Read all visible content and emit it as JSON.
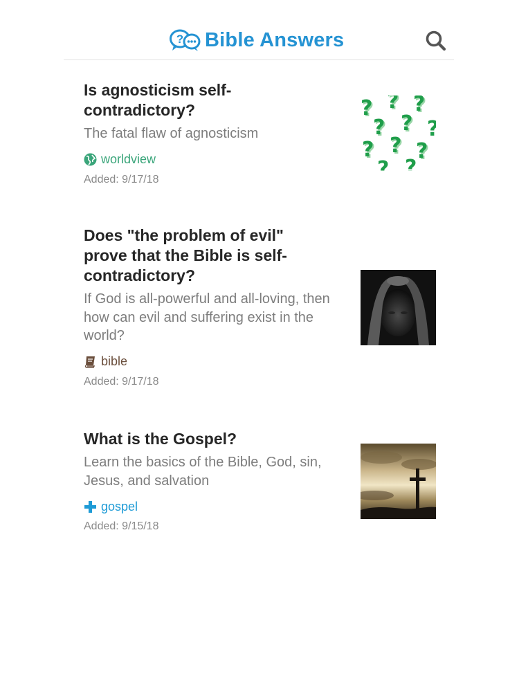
{
  "header": {
    "title": "Bible Answers",
    "logo_icon": "question-chat-bubbles-icon",
    "search_icon": "search-icon",
    "accent_color": "#2593d3"
  },
  "articles": [
    {
      "title": "Is agnosticism self-contradictory?",
      "subtitle": "The fatal flaw of agnosticism",
      "tag": "worldview",
      "tag_icon": "globe-icon",
      "tag_color": "#3aa57a",
      "date": "Added: 9/17/18",
      "thumbnail": "green-question-marks-image"
    },
    {
      "title": "Does \"the problem of evil\" prove that the Bible is self-contradictory?",
      "subtitle": "If God is all-powerful and all-loving, then how can evil and suffering exist in the world?",
      "tag": "bible",
      "tag_icon": "book-icon",
      "tag_color": "#6b4f3d",
      "date": "Added: 9/17/18",
      "thumbnail": "man-head-in-hands-image"
    },
    {
      "title": "What is the Gospel?",
      "subtitle": "Learn the basics of the Bible, God, sin, Jesus, and salvation",
      "tag": "gospel",
      "tag_icon": "plus-cross-icon",
      "tag_color": "#1e9bd6",
      "date": "Added: 9/15/18",
      "thumbnail": "cross-sunset-image"
    }
  ]
}
